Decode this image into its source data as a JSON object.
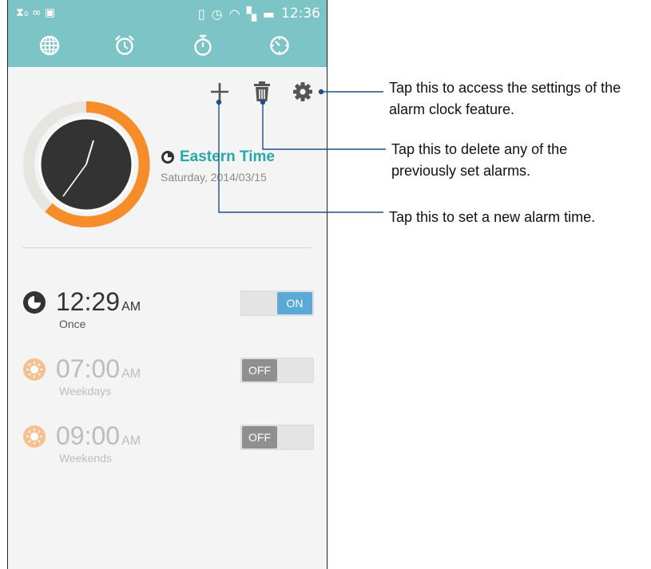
{
  "status_bar": {
    "left_icons": "⧗₀ ∞ ▣",
    "right_icons": [
      "vibrate-icon",
      "alarm-icon",
      "wifi-icon",
      "sim-icon",
      "battery-icon"
    ],
    "time": "12:36"
  },
  "tabs": [
    {
      "name": "world-clock",
      "icon": "globe-icon"
    },
    {
      "name": "alarm",
      "icon": "alarm-clock-icon",
      "active": true
    },
    {
      "name": "stopwatch",
      "icon": "stopwatch-icon"
    },
    {
      "name": "timer",
      "icon": "timer-icon"
    }
  ],
  "toolbar": {
    "add_icon": "plus-icon",
    "delete_icon": "trash-icon",
    "settings_icon": "gear-icon"
  },
  "clock": {
    "timezone": "Eastern Time",
    "date": "Saturday, 2014/03/15",
    "hour": 12,
    "minute": 36
  },
  "alarms": [
    {
      "time": "12:29",
      "ampm": "AM",
      "repeat": "Once",
      "state": "ON",
      "enabled": true,
      "icon": "moon-icon"
    },
    {
      "time": "07:00",
      "ampm": "AM",
      "repeat": "Weekdays",
      "state": "OFF",
      "enabled": false,
      "icon": "sun-icon"
    },
    {
      "time": "09:00",
      "ampm": "AM",
      "repeat": "Weekends",
      "state": "OFF",
      "enabled": false,
      "icon": "sun-icon"
    }
  ],
  "callouts": {
    "settings": [
      "Tap this to access the settings of the",
      "alarm clock feature."
    ],
    "delete": [
      "Tap this to delete any of the",
      "previously set alarms."
    ],
    "add": [
      "Tap this to set a new alarm time."
    ]
  },
  "colors": {
    "accent": "#7cc4c6",
    "teal_text": "#24a8a8",
    "orange": "#f78c2b",
    "toggle_on": "#5ba9d6"
  }
}
